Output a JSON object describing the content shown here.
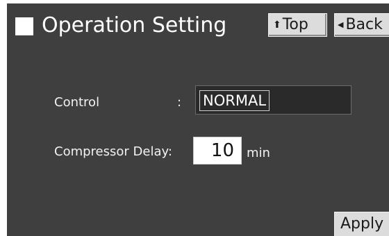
{
  "header": {
    "title": "Operation Setting",
    "title_icon": "white-square-icon",
    "top_button": {
      "label": "Top",
      "icon": "arrow-up-icon",
      "glyph": "⬆"
    },
    "back_button": {
      "label": "Back",
      "icon": "triangle-left-icon",
      "glyph": "◀"
    }
  },
  "form": {
    "control": {
      "label": "Control",
      "separator": ":",
      "value": "NORMAL"
    },
    "compressor_delay": {
      "label": "Compressor Delay:",
      "value": "10",
      "unit": "min"
    }
  },
  "footer": {
    "apply_label": "Apply"
  },
  "colors": {
    "background": "#3f3f3f",
    "button_face": "#dcdcdc",
    "field_dark": "#2a2a2a",
    "field_light": "#ffffff",
    "text": "#ffffff"
  }
}
